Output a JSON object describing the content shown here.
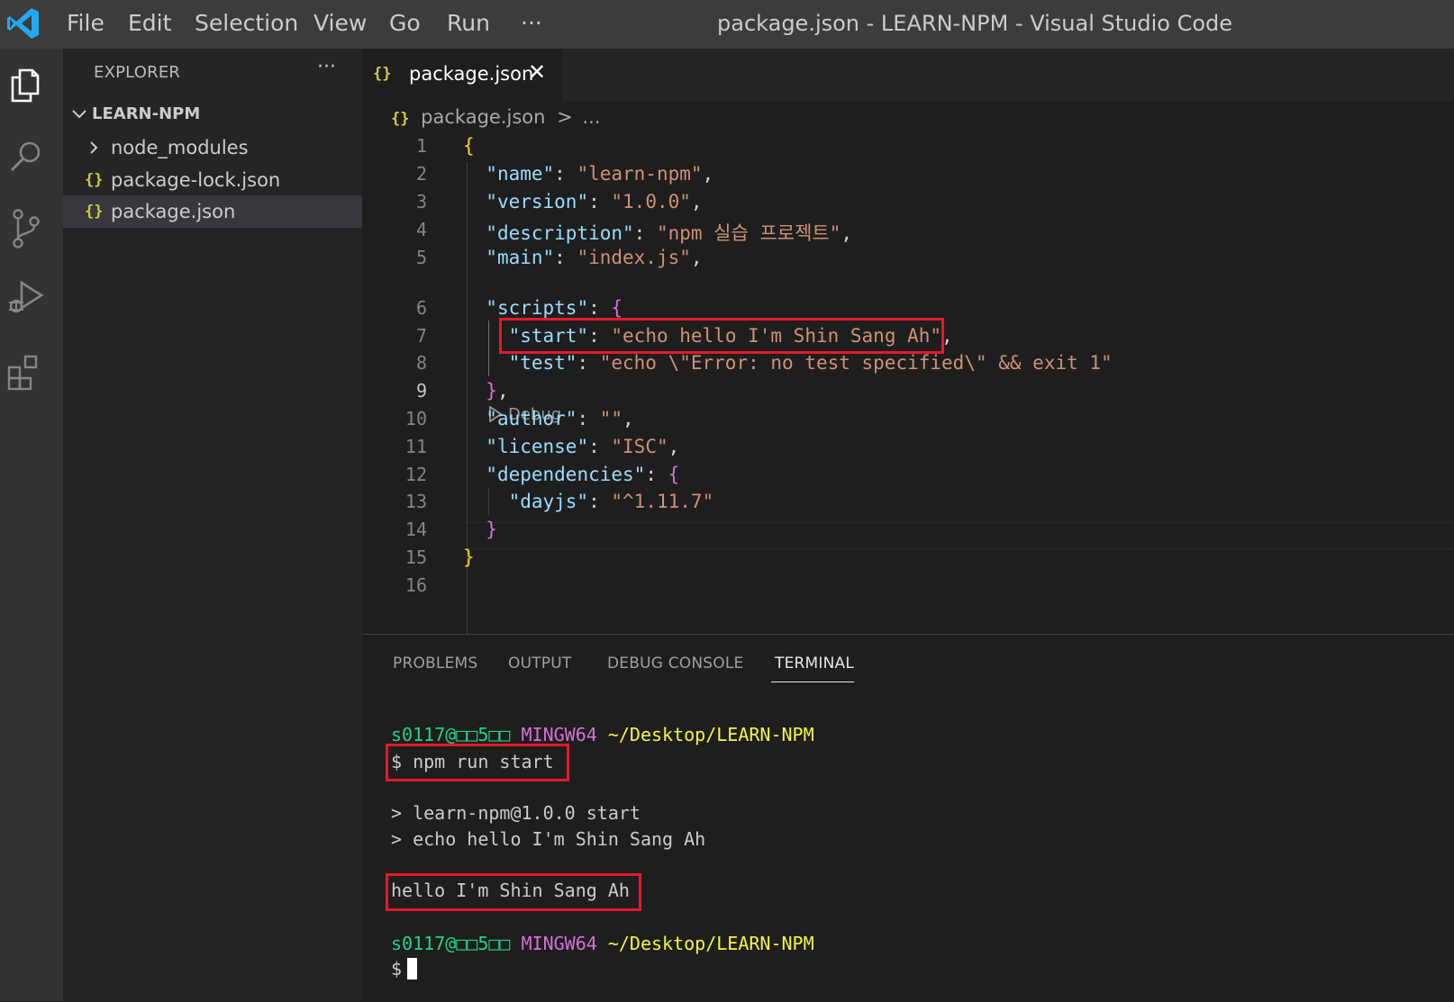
{
  "titlebar": {
    "menu": [
      "File",
      "Edit",
      "Selection",
      "View",
      "Go",
      "Run",
      "···"
    ],
    "title": "package.json - LEARN-NPM - Visual Studio Code"
  },
  "activitybar": {
    "icons": [
      "explorer-icon",
      "search-icon",
      "source-control-icon",
      "run-debug-icon",
      "extensions-icon"
    ]
  },
  "sidebar": {
    "title": "EXPLORER",
    "more": "···",
    "folder": "LEARN-NPM",
    "items": [
      {
        "label": "node_modules",
        "type": "folder"
      },
      {
        "label": "package-lock.json",
        "type": "json"
      },
      {
        "label": "package.json",
        "type": "json",
        "selected": true
      }
    ],
    "json_icon": "{}",
    "chevron_down": "⌄",
    "chevron_right": "›"
  },
  "tab": {
    "icon": "{}",
    "label": "package.json",
    "close": "✕"
  },
  "breadcrumb": {
    "icon": "{}",
    "file": "package.json",
    "sep": ">",
    "rest": "..."
  },
  "editor": {
    "line_numbers": [
      "1",
      "2",
      "3",
      "4",
      "5",
      "6",
      "7",
      "8",
      "9",
      "10",
      "11",
      "12",
      "13",
      "14",
      "15",
      "16"
    ],
    "current_line": "9",
    "codelens": "Debug",
    "lines": {
      "l1_brace": "{",
      "name_key": "\"name\"",
      "name_val": "\"learn-npm\"",
      "version_key": "\"version\"",
      "version_val": "\"1.0.0\"",
      "desc_key": "\"description\"",
      "desc_val": "\"npm 실습 프로젝트\"",
      "main_key": "\"main\"",
      "main_val": "\"index.js\"",
      "scripts_key": "\"scripts\"",
      "scripts_brace": "{",
      "start_key": "\"start\"",
      "start_val": "\"echo hello I'm Shin Sang Ah\"",
      "test_key": "\"test\"",
      "test_val": "\"echo \\\"Error: no test specified\\\" && exit 1\"",
      "scripts_close": "}",
      "author_key": "\"author\"",
      "author_val": "\"\"",
      "license_key": "\"license\"",
      "license_val": "\"ISC\"",
      "deps_key": "\"dependencies\"",
      "deps_brace": "{",
      "dayjs_key": "\"dayjs\"",
      "dayjs_val": "\"^1.11.7\"",
      "deps_close": "}",
      "l15_brace": "}"
    }
  },
  "panel": {
    "tabs": [
      "PROBLEMS",
      "OUTPUT",
      "DEBUG CONSOLE",
      "TERMINAL"
    ],
    "active_tab": "TERMINAL",
    "terminal": {
      "user": "s0117@□□5□□",
      "env": "MINGW64",
      "path": "~/Desktop/LEARN-NPM",
      "command": "$ npm run start",
      "out1": "> learn-npm@1.0.0 start",
      "out2": "> echo hello I'm Shin Sang Ah",
      "result": "hello I'm Shin Sang Ah",
      "prompt": "$"
    }
  },
  "colors": {
    "highlight_box": "#e8182a",
    "key": "#9cdcfe",
    "string": "#ce9178",
    "json_icon": "#cbcb41"
  }
}
